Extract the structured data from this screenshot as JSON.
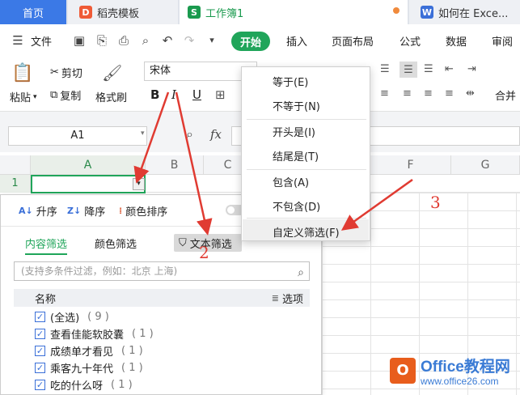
{
  "tabs": {
    "home": "首页",
    "t2": "稻壳模板",
    "t3": "工作簿1",
    "t4": "如何在 Exce...",
    "t2_icon": "D",
    "t3_icon": "S",
    "t4_icon": "W"
  },
  "menu": {
    "file": "文件",
    "start": "开始",
    "insert": "插入",
    "layout": "页面布局",
    "formula": "公式",
    "data": "数据",
    "review": "审阅"
  },
  "ribbon": {
    "paste": "粘贴",
    "cut": "剪切",
    "copy": "复制",
    "painter": "格式刷",
    "font": "宋体",
    "merge": "合并"
  },
  "formula_bar": {
    "cell_ref": "A1",
    "fx": "fx"
  },
  "grid": {
    "columns": [
      "A",
      "B",
      "C",
      "F",
      "G"
    ],
    "row1": "1"
  },
  "panel": {
    "asc": "升序",
    "desc": "降序",
    "color_sort": "颜色排序",
    "tab_content": "内容筛选",
    "tab_color": "颜色筛选",
    "text_filter": "文本筛选",
    "search_placeholder": "(支持多条件过滤，例如：北京  上海)",
    "list_header": "名称",
    "options": "选项",
    "items": [
      {
        "label": "(全选)",
        "count": "( 9 )"
      },
      {
        "label": "查看佳能软胶囊",
        "count": "( 1 )"
      },
      {
        "label": "成绩单才看见",
        "count": "( 1 )"
      },
      {
        "label": "乘客九十年代",
        "count": "( 1 )"
      },
      {
        "label": "吃的什么呀",
        "count": "( 1 )"
      }
    ]
  },
  "dropdown": {
    "items": [
      "等于(E)",
      "不等于(N)",
      "开头是(I)",
      "结尾是(T)",
      "包含(A)",
      "不包含(D)",
      "自定义筛选(F)"
    ]
  },
  "annotations": {
    "n2": "2",
    "n3": "3"
  },
  "watermark": {
    "title": "Office教程网",
    "url": "www.office26.com"
  },
  "colors": {
    "accent": "#20a55a",
    "tab_blue": "#3b79e6",
    "arrow_red": "#e03b32"
  }
}
